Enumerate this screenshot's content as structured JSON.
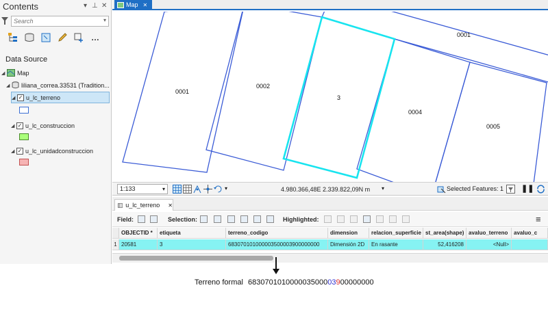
{
  "contents": {
    "title": "Contents",
    "search_placeholder": "Search",
    "data_source_label": "Data Source",
    "tree": {
      "map": "Map",
      "database": "liliana_correa.33531 (Tradition...",
      "layers": [
        {
          "name": "u_lc_terreno",
          "symbol_fill": "#ffffff",
          "symbol_stroke": "#3b6fd4"
        },
        {
          "name": "u_lc_construccion",
          "symbol_fill": "#aaff7a",
          "symbol_stroke": "#4a8a2a"
        },
        {
          "name": "u_lc_unidadconstruccion",
          "symbol_fill": "#f6b4b4",
          "symbol_stroke": "#c25050"
        }
      ]
    }
  },
  "map_view": {
    "tab": "Map",
    "parcel_labels": [
      "0001",
      "0002",
      "3",
      "0004",
      "0005",
      "0001"
    ],
    "colors": {
      "parcel": "#3a5bd6",
      "selected": "#18e4ef"
    },
    "status": {
      "scale": "1:133",
      "coordinates": "4.980.366,48E 2.339.822,09N m",
      "selected_features": "Selected Features: 1"
    }
  },
  "attribute_table": {
    "tab": "u_lc_terreno",
    "toolbar": {
      "field": "Field:",
      "selection": "Selection:",
      "highlighted": "Highlighted:"
    },
    "columns": [
      "OBJECTID *",
      "etiqueta",
      "terreno_codigo",
      "dimension",
      "relacion_superficie",
      "st_area(shape)",
      "avaluo_terreno",
      "avaluo_c"
    ],
    "rows": [
      {
        "num": "1",
        "cells": [
          "20581",
          "3",
          "683070101000003500003900000000",
          "Dimensión 2D",
          "En rasante",
          "52,416208",
          "<Null>",
          ""
        ]
      }
    ]
  },
  "caption": {
    "label": "Terreno formal",
    "value_parts": [
      "6830701010000035000",
      "03",
      "9",
      "00000000"
    ]
  }
}
